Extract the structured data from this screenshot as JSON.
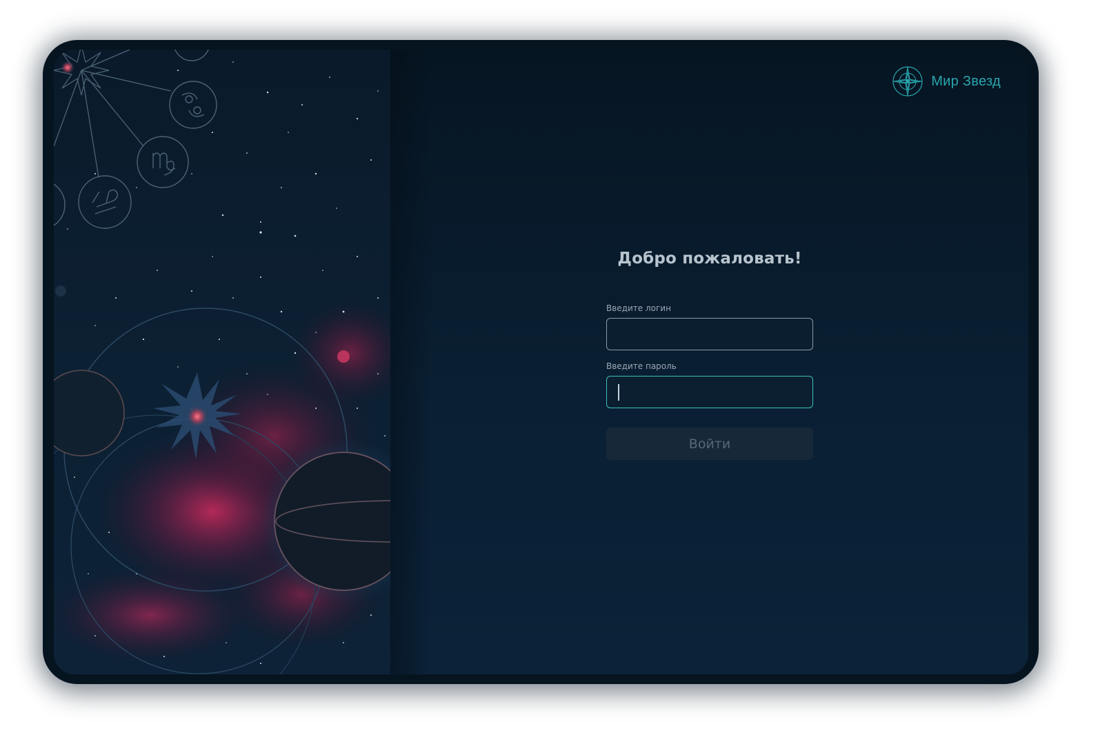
{
  "app": {
    "name": "Мир Звезд"
  },
  "login": {
    "title": "Добро пожаловать!",
    "login_label": "Введите логин",
    "login_value": "",
    "password_label": "Введите пароль",
    "password_value": "",
    "submit_label": "Войти",
    "submit_enabled": false,
    "focused_field": "password"
  },
  "decor": {
    "zodiac_icons": [
      "cancer-icon",
      "virgo-icon",
      "libra-icon"
    ]
  },
  "colors": {
    "accent": "#3cc0b8",
    "logo": "#2aa6ae",
    "background": "#0a1f33",
    "nebula": "#c8245a"
  }
}
